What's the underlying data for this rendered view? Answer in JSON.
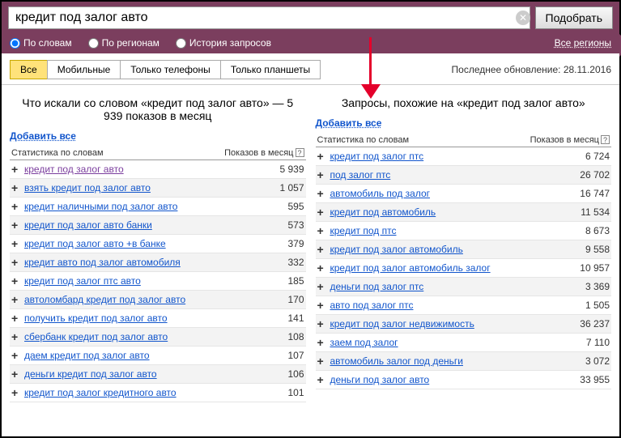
{
  "search": {
    "value": "кредит под залог авто",
    "submit": "Подобрать"
  },
  "filters": {
    "by_words": "По словам",
    "by_regions": "По регионам",
    "history": "История запросов",
    "regions_link": "Все регионы"
  },
  "tabs": {
    "all": "Все",
    "mobile": "Мобильные",
    "phones": "Только телефоны",
    "tablets": "Только планшеты",
    "updated": "Последнее обновление: 28.11.2016"
  },
  "left": {
    "title": "Что искали со словом «кредит под залог авто» — 5 939 показов в месяц",
    "add_all": "Добавить все",
    "head1": "Статистика по словам",
    "head2": "Показов в месяц",
    "rows": [
      {
        "kw": "кредит под залог авто",
        "n": "5 939",
        "v": true
      },
      {
        "kw": "взять кредит под залог авто",
        "n": "1 057"
      },
      {
        "kw": "кредит наличными под залог авто",
        "n": "595"
      },
      {
        "kw": "кредит под залог авто банки",
        "n": "573"
      },
      {
        "kw": "кредит под залог авто +в банке",
        "n": "379"
      },
      {
        "kw": "кредит авто под залог автомобиля",
        "n": "332"
      },
      {
        "kw": "кредит под залог птс авто",
        "n": "185"
      },
      {
        "kw": "автоломбард кредит под залог авто",
        "n": "170"
      },
      {
        "kw": "получить кредит под залог авто",
        "n": "141"
      },
      {
        "kw": "сбербанк кредит под залог авто",
        "n": "108"
      },
      {
        "kw": "даем кредит под залог авто",
        "n": "107"
      },
      {
        "kw": "деньги кредит под залог авто",
        "n": "106"
      },
      {
        "kw": "кредит под залог кредитного авто",
        "n": "101"
      }
    ]
  },
  "right": {
    "title": "Запросы, похожие на «кредит под залог авто»",
    "add_all": "Добавить все",
    "head1": "Статистика по словам",
    "head2": "Показов в месяц",
    "rows": [
      {
        "kw": "кредит под залог птс",
        "n": "6 724"
      },
      {
        "kw": "под залог птс",
        "n": "26 702"
      },
      {
        "kw": "автомобиль под залог",
        "n": "16 747"
      },
      {
        "kw": "кредит под автомобиль",
        "n": "11 534"
      },
      {
        "kw": "кредит под птс",
        "n": "8 673"
      },
      {
        "kw": "кредит под залог автомобиль",
        "n": "9 558"
      },
      {
        "kw": "кредит под залог автомобиль залог",
        "n": "10 957"
      },
      {
        "kw": "деньги под залог птс",
        "n": "3 369"
      },
      {
        "kw": "авто под залог птс",
        "n": "1 505"
      },
      {
        "kw": "кредит под залог недвижимость",
        "n": "36 237"
      },
      {
        "kw": "заем под залог",
        "n": "7 110"
      },
      {
        "kw": "автомобиль залог под деньги",
        "n": "3 072"
      },
      {
        "kw": "деньги под залог авто",
        "n": "33 955"
      }
    ]
  }
}
